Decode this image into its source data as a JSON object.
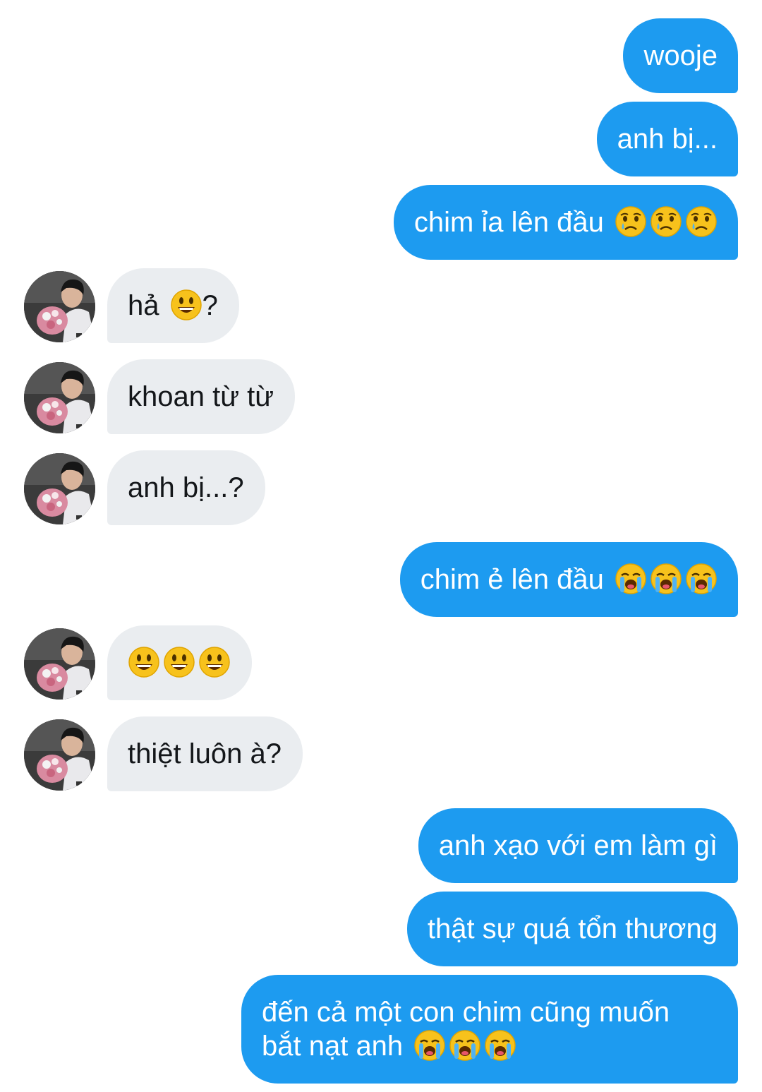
{
  "conversation": {
    "colors": {
      "sent_bubble": "#1d9bf0",
      "received_bubble": "#eaedf0",
      "sent_text": "#ffffff",
      "received_text": "#14171a"
    },
    "messages": [
      {
        "side": "sent",
        "text": "wooje"
      },
      {
        "side": "sent",
        "text": "anh bị..."
      },
      {
        "side": "sent",
        "text": "chim ỉa lên đầu",
        "emoji": "crying-face ×3"
      },
      {
        "side": "received",
        "text": "hả",
        "emoji": "grinning-face",
        "suffix": "?"
      },
      {
        "side": "received",
        "text": "khoan từ từ"
      },
      {
        "side": "received",
        "text": "anh bị...?"
      },
      {
        "side": "sent",
        "text": "chim ẻ lên đầu",
        "emoji": "loudly-crying-face ×3"
      },
      {
        "side": "received",
        "text": "",
        "emoji": "grinning-face ×3"
      },
      {
        "side": "received",
        "text": "thiệt luôn à?"
      },
      {
        "side": "sent",
        "text": "anh xạo với em làm gì"
      },
      {
        "side": "sent",
        "text": "thật sự quá tổn thương"
      },
      {
        "side": "sent",
        "text": "đến cả một con chim cũng muốn",
        "text_line2": "bắt nạt anh",
        "emoji": "loudly-crying-face ×3"
      }
    ]
  }
}
